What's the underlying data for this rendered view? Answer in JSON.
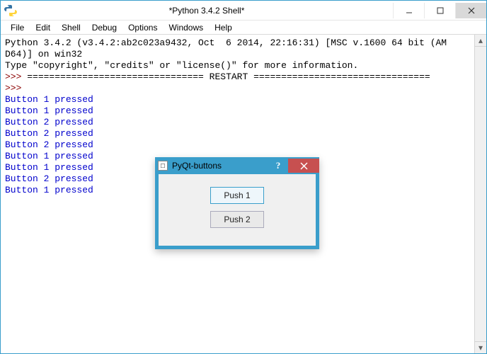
{
  "idle": {
    "title": "*Python 3.4.2 Shell*",
    "menus": [
      "File",
      "Edit",
      "Shell",
      "Debug",
      "Options",
      "Windows",
      "Help"
    ]
  },
  "console": {
    "banner1": "Python 3.4.2 (v3.4.2:ab2c023a9432, Oct  6 2014, 22:16:31) [MSC v.1600 64 bit (AM",
    "banner2": "D64)] on win32",
    "banner3": "Type \"copyright\", \"credits\" or \"license()\" for more information.",
    "restart_prefix": ">>> ",
    "restart_line": "================================ RESTART ================================",
    "prompt": ">>> ",
    "outputs": [
      "Button 1 pressed",
      "Button 1 pressed",
      "Button 2 pressed",
      "Button 2 pressed",
      "Button 2 pressed",
      "Button 1 pressed",
      "Button 1 pressed",
      "Button 2 pressed",
      "Button 1 pressed"
    ]
  },
  "dialog": {
    "title": "PyQt-buttons",
    "help": "?",
    "button1": "Push 1",
    "button2": "Push 2"
  }
}
